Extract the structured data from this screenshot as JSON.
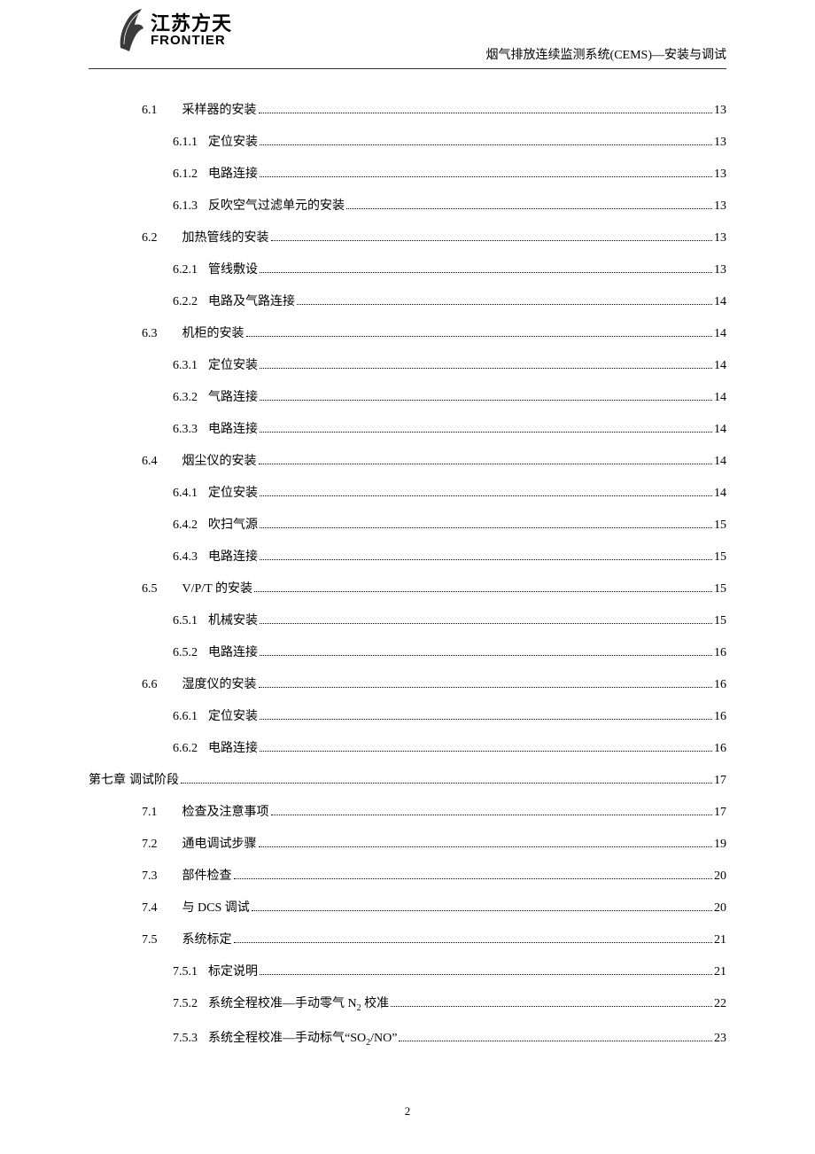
{
  "header": {
    "logo_cn": "江苏方天",
    "logo_en": "FRONTIER",
    "title": "烟气排放连续监测系统(CEMS)—安装与调试"
  },
  "toc": [
    {
      "indent": 1,
      "gap": "wide",
      "num": "6.1",
      "label": "采样器的安装",
      "page": "13"
    },
    {
      "indent": 2,
      "gap": "mid",
      "num": "6.1.1",
      "label": "定位安装",
      "page": "13"
    },
    {
      "indent": 2,
      "gap": "mid",
      "num": "6.1.2",
      "label": "电路连接",
      "page": "13"
    },
    {
      "indent": 2,
      "gap": "mid",
      "num": "6.1.3",
      "label": "反吹空气过滤单元的安装",
      "page": "13"
    },
    {
      "indent": 1,
      "gap": "wide",
      "num": "6.2",
      "label": "加热管线的安装",
      "page": "13"
    },
    {
      "indent": 2,
      "gap": "mid",
      "num": "6.2.1",
      "label": "管线敷设",
      "page": "13"
    },
    {
      "indent": 2,
      "gap": "mid",
      "num": "6.2.2",
      "label": "电路及气路连接",
      "page": "14"
    },
    {
      "indent": 1,
      "gap": "wide",
      "num": "6.3",
      "label": "机柜的安装",
      "page": "14"
    },
    {
      "indent": 2,
      "gap": "mid",
      "num": "6.3.1",
      "label": "定位安装",
      "page": "14"
    },
    {
      "indent": 2,
      "gap": "mid",
      "num": "6.3.2",
      "label": "气路连接",
      "page": "14"
    },
    {
      "indent": 2,
      "gap": "mid",
      "num": "6.3.3",
      "label": "电路连接",
      "page": "14"
    },
    {
      "indent": 1,
      "gap": "wide",
      "num": "6.4",
      "label": "烟尘仪的安装",
      "page": "14"
    },
    {
      "indent": 2,
      "gap": "mid",
      "num": "6.4.1",
      "label": "定位安装",
      "page": "14"
    },
    {
      "indent": 2,
      "gap": "mid",
      "num": "6.4.2",
      "label": "吹扫气源",
      "page": "15"
    },
    {
      "indent": 2,
      "gap": "mid",
      "num": "6.4.3",
      "label": "电路连接",
      "page": "15"
    },
    {
      "indent": 1,
      "gap": "wide",
      "num": "6.5",
      "label": "V/P/T 的安装",
      "page": "15"
    },
    {
      "indent": 2,
      "gap": "mid",
      "num": "6.5.1",
      "label": "机械安装",
      "page": "15"
    },
    {
      "indent": 2,
      "gap": "mid",
      "num": "6.5.2",
      "label": "电路连接",
      "page": "16"
    },
    {
      "indent": 1,
      "gap": "wide",
      "num": "6.6",
      "label": "湿度仪的安装",
      "page": "16"
    },
    {
      "indent": 2,
      "gap": "mid",
      "num": "6.6.1",
      "label": "定位安装",
      "page": "16"
    },
    {
      "indent": 2,
      "gap": "mid",
      "num": "6.6.2",
      "label": "电路连接",
      "page": "16"
    },
    {
      "indent": 0,
      "gap": "none",
      "num": "第七章",
      "label": " 调试阶段",
      "page": "17"
    },
    {
      "indent": 1,
      "gap": "wide",
      "num": "7.1",
      "label": "检查及注意事项",
      "page": "17"
    },
    {
      "indent": 1,
      "gap": "wide",
      "num": "7.2",
      "label": "通电调试步骤",
      "page": "19"
    },
    {
      "indent": 1,
      "gap": "wide",
      "num": "7.3",
      "label": "部件检查",
      "page": "20"
    },
    {
      "indent": 1,
      "gap": "wide",
      "num": "7.4",
      "label": "与 DCS 调试",
      "page": "20"
    },
    {
      "indent": 1,
      "gap": "wide",
      "num": "7.5",
      "label": "系统标定",
      "page": "21"
    },
    {
      "indent": 2,
      "gap": "mid",
      "num": "7.5.1",
      "label": "标定说明",
      "page": "21"
    },
    {
      "indent": 2,
      "gap": "mid",
      "num": "7.5.2",
      "label": "系统全程校准—手动零气 N₂ 校准",
      "page": "22",
      "html": true
    },
    {
      "indent": 2,
      "gap": "mid",
      "num": "7.5.3",
      "label": "系统全程校准—手动标气 \"SO₂/NO\" ",
      "page": "23",
      "html": true
    }
  ],
  "page_number": "2"
}
